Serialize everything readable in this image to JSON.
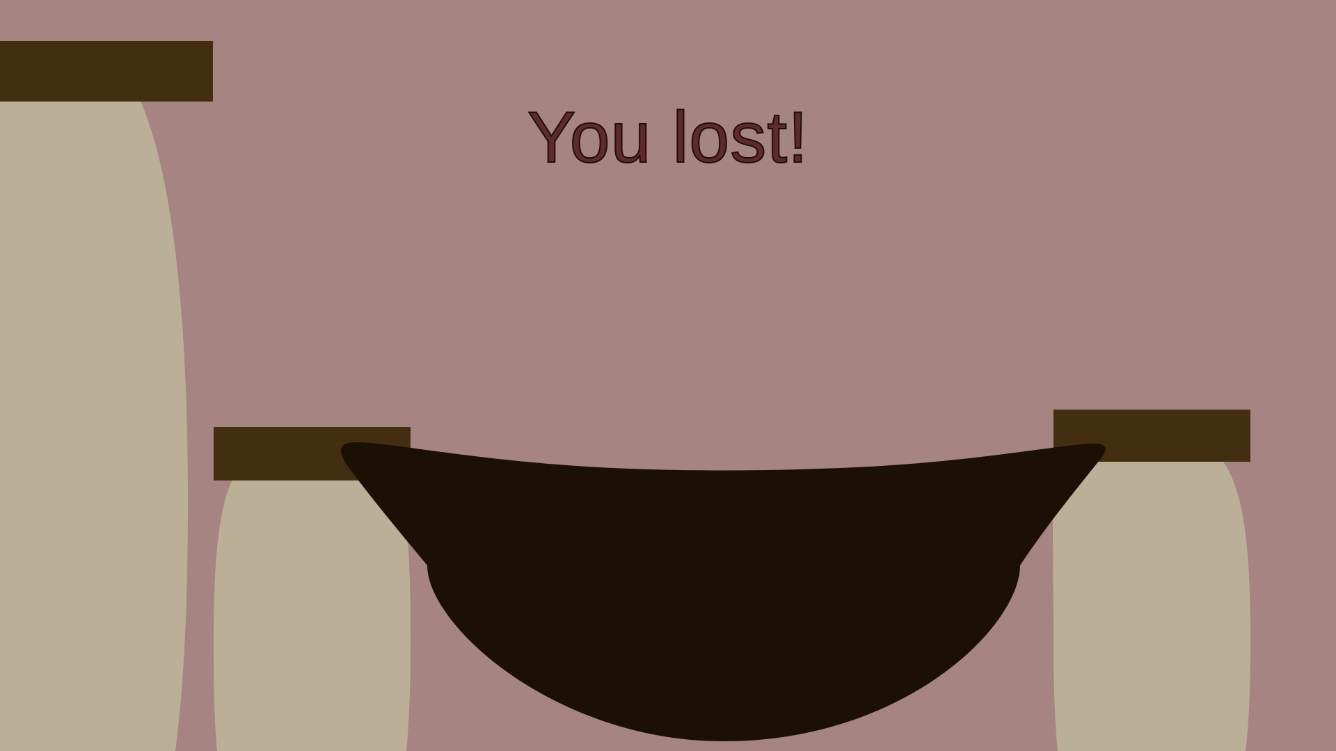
{
  "game": {
    "status_message": "You lost!"
  },
  "colors": {
    "background": "#a58482",
    "jar_body": "#bbaf97",
    "jar_lid": "#442e12",
    "pot": "#1c1004",
    "message_fill": "#5e2a2c",
    "message_outline": "#1c0e0b"
  },
  "objects": {
    "jars": [
      {
        "name": "tall-jar-left",
        "body_icon": "jar-icon",
        "lid_icon": "lid-icon"
      },
      {
        "name": "short-jar-middle",
        "body_icon": "jar-icon",
        "lid_icon": "lid-icon"
      },
      {
        "name": "short-jar-right",
        "body_icon": "jar-icon",
        "lid_icon": "lid-icon"
      }
    ],
    "pot_icon": "pot-icon"
  }
}
